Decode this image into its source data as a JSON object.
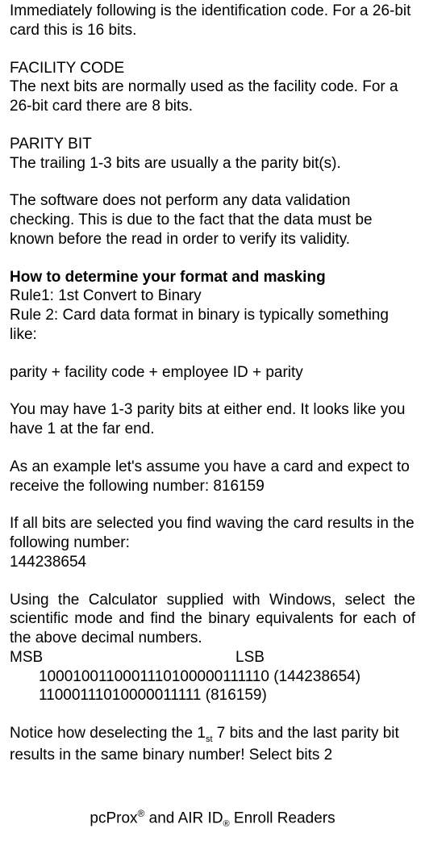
{
  "p1": "Immediately following is the identification code. For a 26-bit card this is 16 bits.",
  "facility_header": "FACILITY CODE",
  "facility_text": "The next bits are normally used as the facility code. For a 26-bit card there are 8 bits.",
  "parity_header": "PARITY BIT",
  "parity_text": "The trailing 1-3 bits are usually a the parity bit(s).",
  "software_text": "The software does not perform any data validation checking. This is due to the fact that the data must be known before the read in order to verify its validity.",
  "howto_header": "How to determine your format and masking",
  "rule1": "Rule1: 1st Convert to Binary",
  "rule2": "Rule 2: Card data format in binary is typically something like:",
  "format_line": "parity + facility code + employee ID + parity",
  "parity_note": "You may have 1-3 parity bits at either end. It looks like you have 1 at the far end.",
  "example_intro": "As an example let's assume you have a card and expect to receive the following number: 816159",
  "all_bits_text": "If all bits are selected you find waving the card results in the following number:",
  "all_bits_number": "144238654",
  "calc_text": "Using the Calculator supplied with Windows, select the scientific mode and find the binary equivalents for each of the above decimal numbers.",
  "msb": "MSB",
  "lsb": "LSB",
  "binary1": "1000100110001110100000111110 (144238654)",
  "binary2": "11000111010000011111 (816159)",
  "notice_prefix": "Notice how deselecting the 1",
  "notice_sub": "st",
  "notice_suffix": " 7 bits and the last parity bit results in the same binary number! Select bits 2",
  "footer_prefix": "pcProx",
  "footer_sup1": "®",
  "footer_mid": " and AIR ID",
  "footer_sup2": "®",
  "footer_suffix": " Enroll Readers"
}
